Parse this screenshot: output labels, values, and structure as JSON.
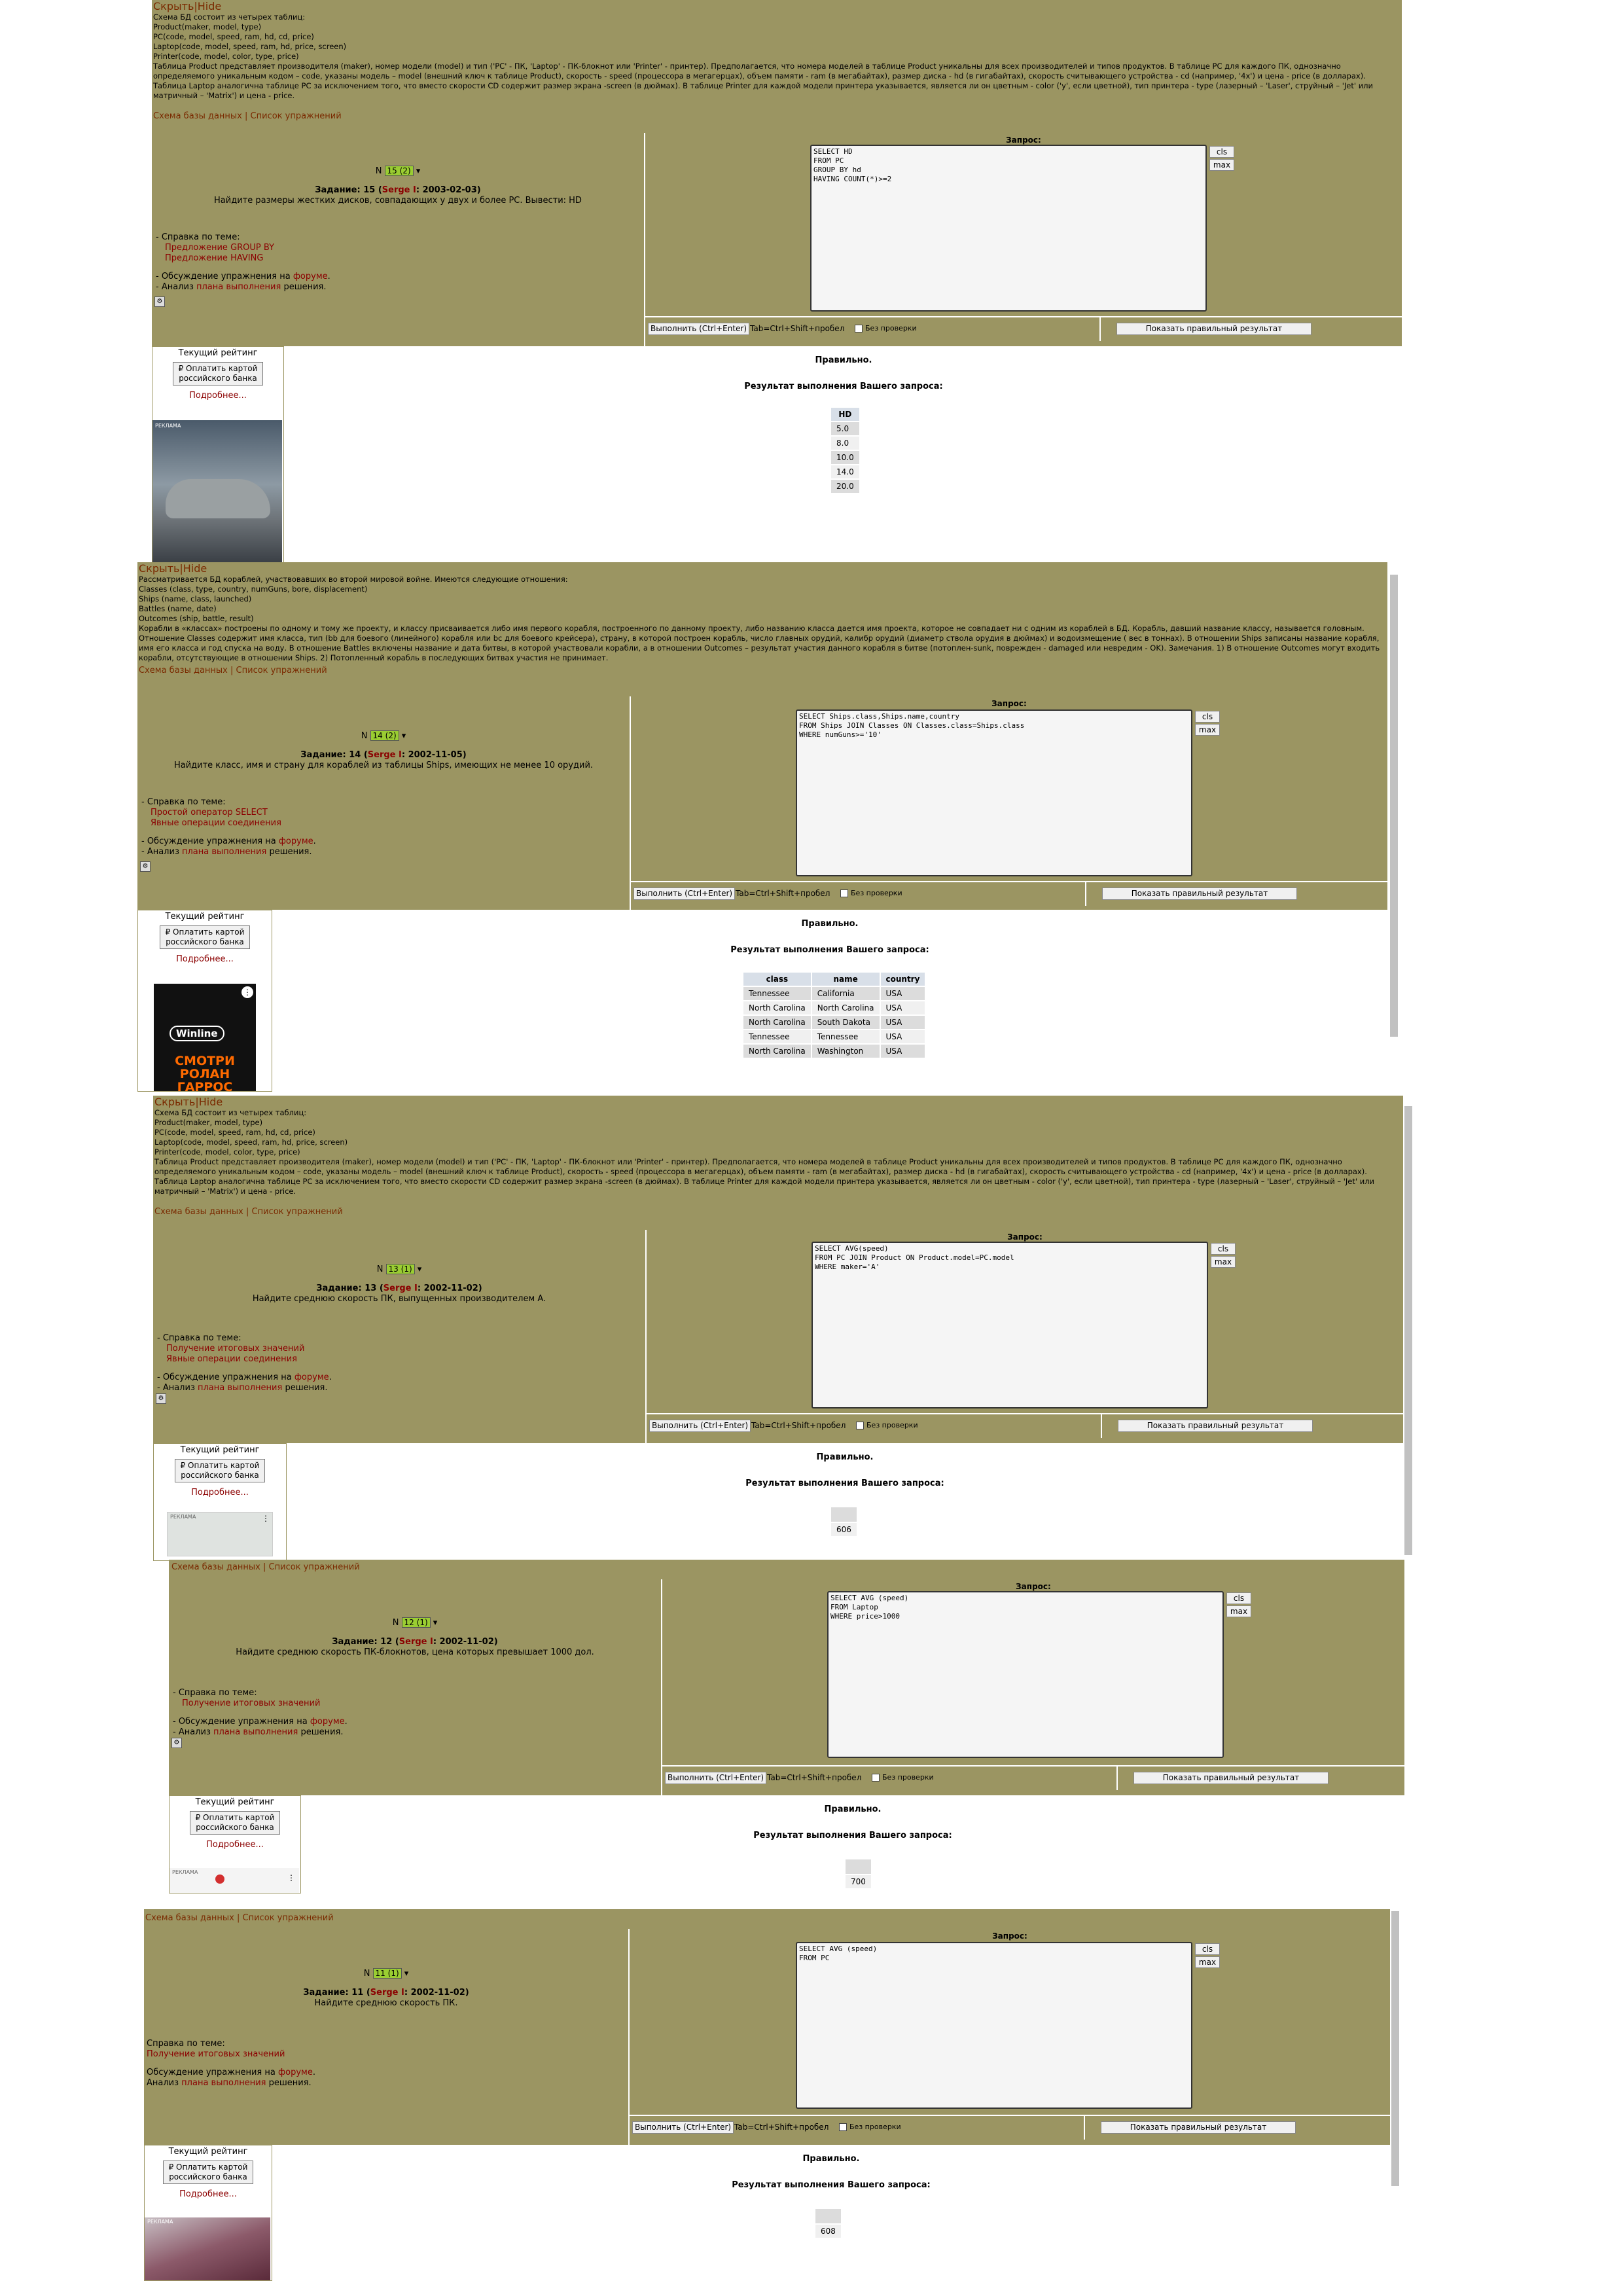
{
  "common": {
    "hide_label": "Скрыть|Hide",
    "schema_link": "Схема базы данных",
    "separator": " | ",
    "exercises_link": "Список упражнений",
    "query_label": "Запрос:",
    "cls_label": "cls",
    "max_label": "max",
    "run_label": "Выполнить (Ctrl+Enter)",
    "tab_hint": "Tab=Ctrl+Shift+пробел",
    "no_check_label": "Без проверки",
    "show_correct_label": "Показать правильный результат",
    "help_title": "- Справка по теме:",
    "help_title_plain": "Справка по теме:",
    "discussion_prefix": "- Обсуждение упражнения на ",
    "discussion_prefix_plain": "Обсуждение упражнения на ",
    "forum_link": "форуме",
    "analysis_prefix": "- Анализ ",
    "analysis_prefix_plain": "Анализ ",
    "plan_link": "плана выполнения",
    "analysis_suffix": " решения.",
    "rating_label": "Текущий рейтинг",
    "pay_label": "₽ Оплатить картой российского банка",
    "more_label": "Подробнее...",
    "correct_label": "Правильно.",
    "result_title": "Результат выполнения Вашего запроса:"
  },
  "schema_computers": {
    "lines": [
      "Схема БД состоит из четырех таблиц:",
      "Product(maker, model, type)",
      "PC(code, model, speed, ram, hd, cd, price)",
      "Laptop(code, model, speed, ram, hd, price, screen)",
      "Printer(code, model, color, type, price)"
    ],
    "description": "Таблица Product представляет производителя (maker), номер модели (model) и тип ('PC' - ПК, 'Laptop' - ПК-блокнот или 'Printer' - принтер). Предполагается, что номера моделей в таблице Product уникальны для всех производителей и типов продуктов. В таблице PC для каждого ПК, однозначно определяемого уникальным кодом – code, указаны модель – model (внешний ключ к таблице Product), скорость - speed (процессора в мегагерцах), объем памяти - ram (в мегабайтах), размер диска - hd (в гигабайтах), скорость считывающего устройства - cd (например, '4x') и цена - price (в долларах). Таблица Laptop аналогична таблице РС за исключением того, что вместо скорости CD содержит размер экрана -screen (в дюймах). В таблице Printer для каждой модели принтера указывается, является ли он цветным - color ('y', если цветной), тип принтера - type (лазерный – 'Laser', струйный – 'Jet' или матричный – 'Matrix') и цена - price."
  },
  "schema_ships": {
    "lines": [
      "Рассматривается БД кораблей, участвовавших во второй мировой войне. Имеются следующие отношения:",
      "Classes (class, type, country, numGuns, bore, displacement)",
      "Ships (name, class, launched)",
      "Battles (name, date)",
      "Outcomes (ship, battle, result)"
    ],
    "description": "Корабли в «классах» построены по одному и тому же проекту, и классу присваивается либо имя первого корабля, построенного по данному проекту, либо названию класса дается имя проекта, которое не совпадает ни с одним из кораблей в БД. Корабль, давший название классу, называется головным. Отношение Classes содержит имя класса, тип (bb для боевого (линейного) корабля или bc для боевого крейсера), страну, в которой построен корабль, число главных орудий, калибр орудий (диаметр ствола орудия в дюймах) и водоизмещение ( вес в тоннах). В отношении Ships записаны название корабля, имя его класса и год спуска на воду. В отношение Battles включены название и дата битвы, в которой участвовали корабли, а в отношении Outcomes – результат участия данного корабля в битве (потоплен-sunk, поврежден - damaged или невредим - OK). Замечания. 1) В отношение Outcomes могут входить корабли, отсутствующие в отношении Ships. 2) Потопленный корабль в последующих битвах участия не принимает."
  },
  "panels": [
    {
      "task_select": "15 (2)",
      "task_no_prefix": "Задание: 15 (",
      "author": "Serge I",
      "task_date": ": 2003-02-03)",
      "task_text": "Найдите размеры жестких дисков, совпадающих у двух и более PC. Вывести: HD",
      "help_links": [
        "Предложение GROUP BY",
        "Предложение HAVING"
      ],
      "sql": "SELECT HD\nFROM PC\nGROUP BY hd\nHAVING COUNT(*)>=2",
      "result": {
        "headers": [
          "HD"
        ],
        "rows": [
          [
            "5.0"
          ],
          [
            "8.0"
          ],
          [
            "10.0"
          ],
          [
            "14.0"
          ],
          [
            "20.0"
          ]
        ]
      },
      "ad_label": "РЕКЛАМА"
    },
    {
      "task_select": "14 (2)",
      "task_no_prefix": "Задание: 14 (",
      "author": "Serge I",
      "task_date": ": 2002-11-05)",
      "task_text": "Найдите класс, имя и страну для кораблей из таблицы Ships, имеющих не менее 10 орудий.",
      "help_links": [
        "Простой оператор SELECT",
        "Явные операции соединения"
      ],
      "sql": "SELECT Ships.class,Ships.name,country\nFROM Ships JOIN Classes ON Classes.class=Ships.class\nWHERE numGuns>='10'",
      "result": {
        "headers": [
          "class",
          "name",
          "country"
        ],
        "rows": [
          [
            "Tennessee",
            "California",
            "USA"
          ],
          [
            "North Carolina",
            "North Carolina",
            "USA"
          ],
          [
            "North Carolina",
            "South Dakota",
            "USA"
          ],
          [
            "Tennessee",
            "Tennessee",
            "USA"
          ],
          [
            "North Carolina",
            "Washington",
            "USA"
          ]
        ]
      },
      "ad_brand": "Winline",
      "ad_text": "СМОТРИ РОЛАН ГАРРОС"
    },
    {
      "task_select": "13 (1)",
      "task_no_prefix": "Задание: 13 (",
      "author": "Serge I",
      "task_date": ": 2002-11-02)",
      "task_text": "Найдите среднюю скорость ПК, выпущенных производителем A.",
      "help_links": [
        "Получение итоговых значений",
        "Явные операции соединения"
      ],
      "sql": "SELECT AVG(speed)\nFROM PC JOIN Product ON Product.model=PC.model\nWHERE maker='A'",
      "result_value": "606",
      "ad_label": "РЕКЛАМА"
    },
    {
      "task_select": "12 (1)",
      "task_no_prefix": "Задание: 12 (",
      "author": "Serge I",
      "task_date": ": 2002-11-02)",
      "task_text": "Найдите среднюю скорость ПК-блокнотов, цена которых превышает 1000 дол.",
      "help_links": [
        "Получение итоговых значений"
      ],
      "sql": "SELECT AVG (speed)\nFROM Laptop\nWHERE price>1000",
      "result_value": "700",
      "ad_label": "РЕКЛАМА"
    },
    {
      "task_select": "11 (1)",
      "task_no_prefix": "Задание: 11 (",
      "author": "Serge I",
      "task_date": ": 2002-11-02)",
      "task_text": "Найдите среднюю скорость ПК.",
      "help_links": [
        "Получение итоговых значений"
      ],
      "sql": "SELECT AVG (speed)\nFROM PC",
      "result_value": "608",
      "ad_label": "РЕКЛАМА"
    }
  ],
  "colors": {
    "panel_bg": "#9b9562",
    "select_bg": "#9ACD32",
    "link": "#8b0000"
  }
}
